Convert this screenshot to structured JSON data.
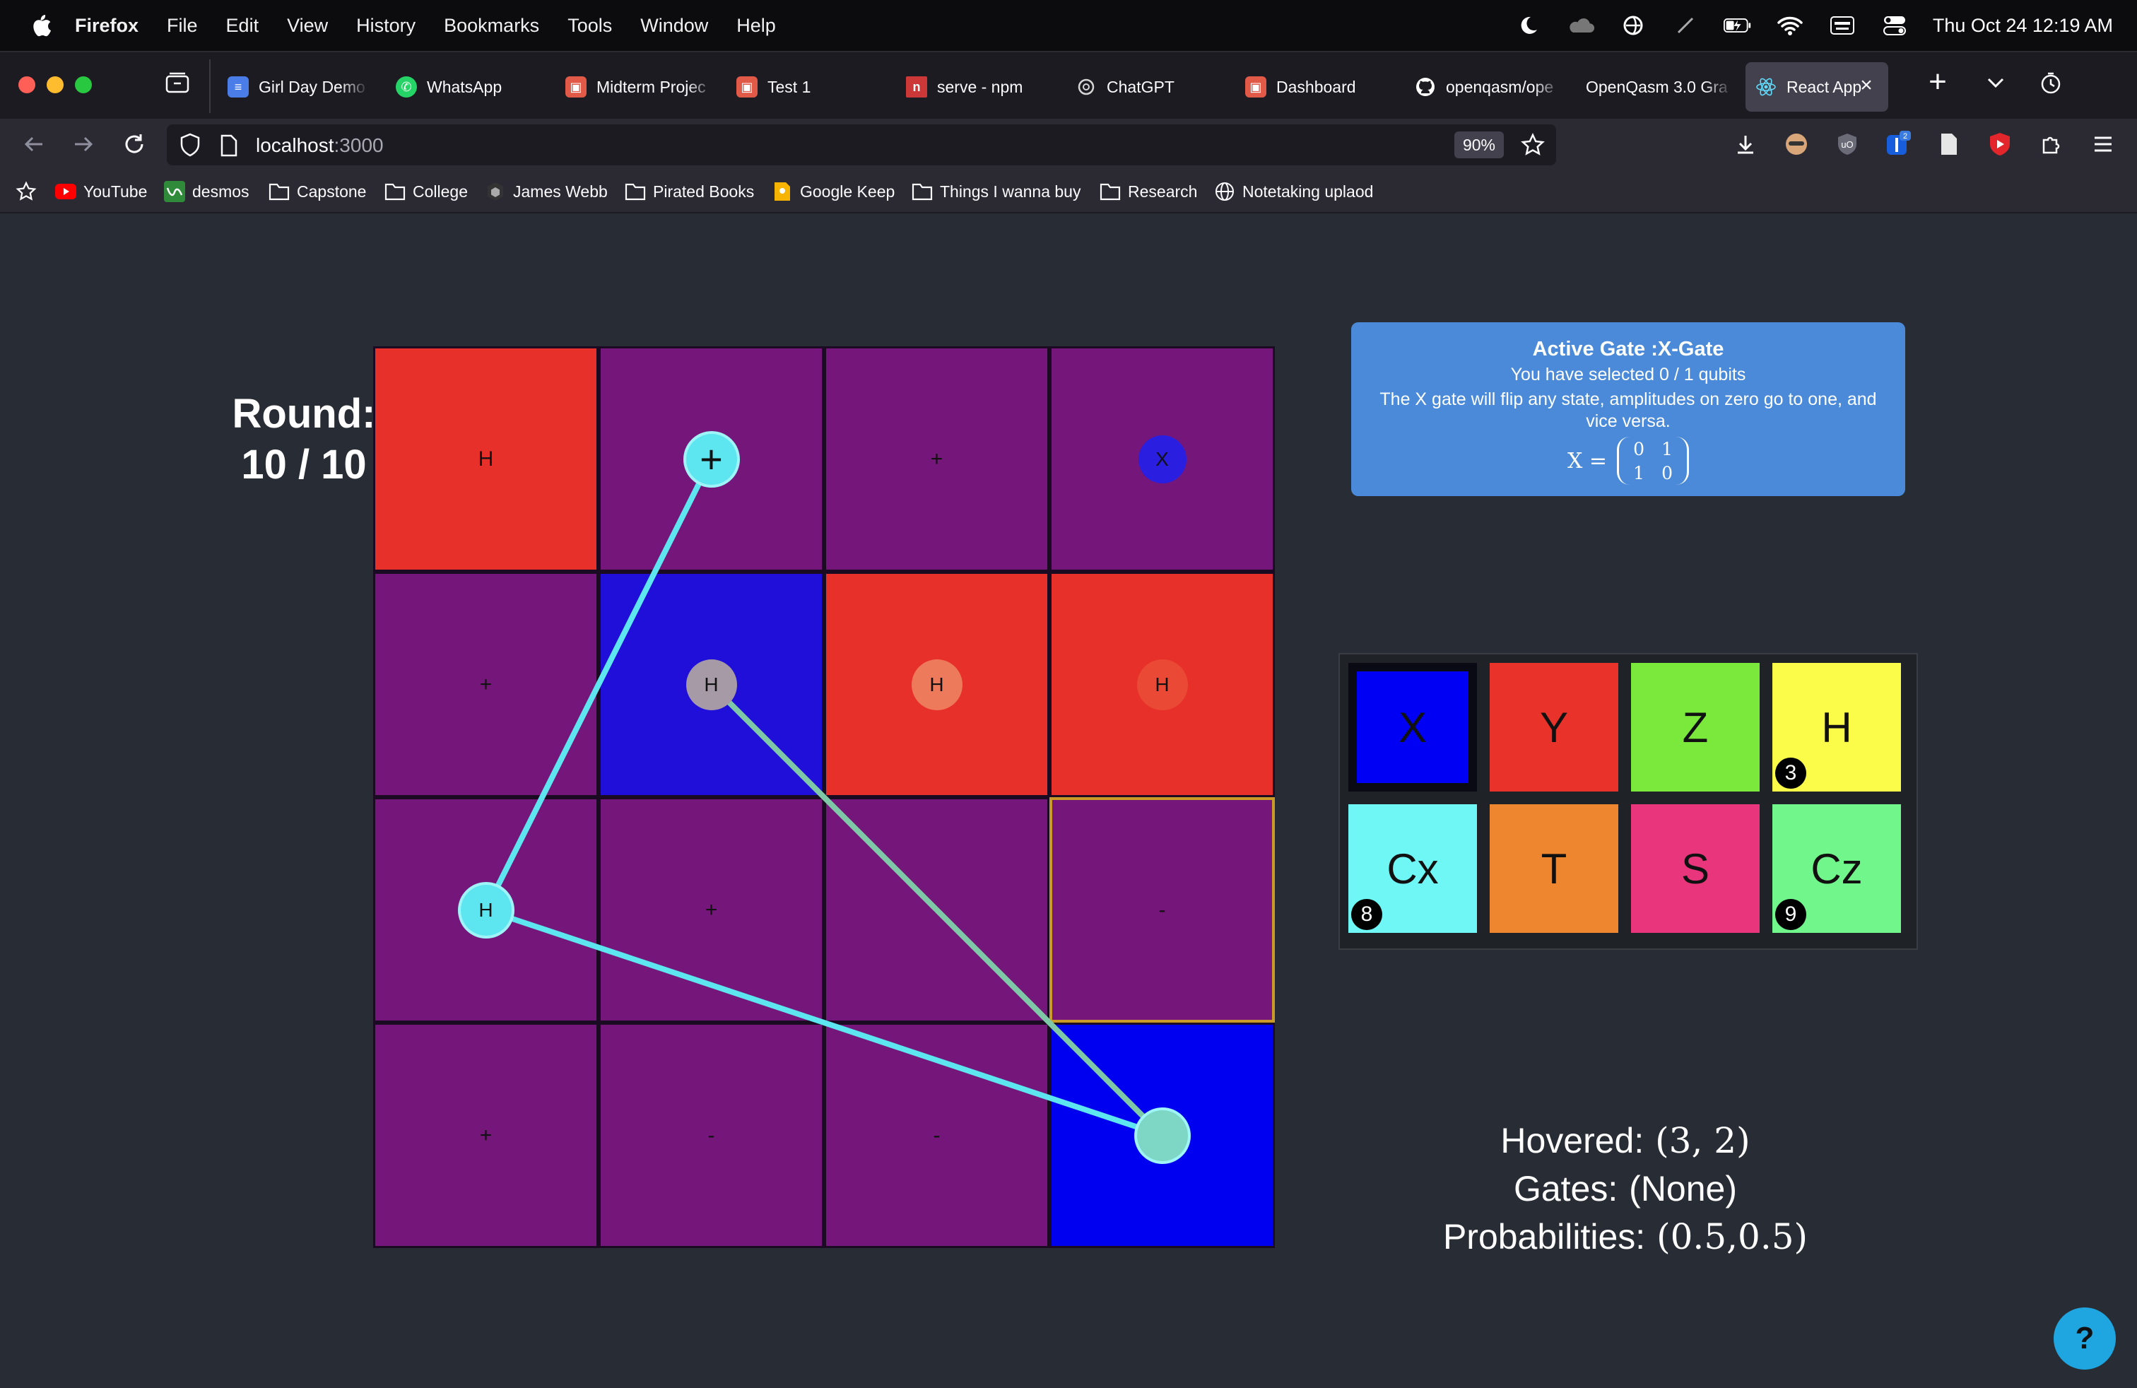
{
  "menubar": {
    "app_name": "Firefox",
    "items": [
      "File",
      "Edit",
      "View",
      "History",
      "Bookmarks",
      "Tools",
      "Window",
      "Help"
    ],
    "clock": "Thu Oct 24  12:19 AM"
  },
  "tabs": [
    {
      "title": "Girl Day Demo",
      "icon": "google-docs-icon",
      "color": "#4a7de8"
    },
    {
      "title": "WhatsApp",
      "icon": "whatsapp-icon",
      "color": "#25d366"
    },
    {
      "title": "Midterm Projec",
      "icon": "canvas-icon",
      "color": "#e05a47"
    },
    {
      "title": "Test 1",
      "icon": "canvas-icon",
      "color": "#e05a47"
    },
    {
      "title": "serve - npm",
      "icon": "npm-icon",
      "color": "#cb3837"
    },
    {
      "title": "ChatGPT",
      "icon": "chatgpt-icon",
      "color": "#d6d6d6"
    },
    {
      "title": "Dashboard",
      "icon": "canvas-icon",
      "color": "#e05a47"
    },
    {
      "title": "openqasm/ope",
      "icon": "github-icon",
      "color": "#ffffff"
    },
    {
      "title": "OpenQasm 3.0 Gra",
      "icon": "",
      "color": ""
    },
    {
      "title": "React App",
      "icon": "react-icon",
      "color": "#61dafb",
      "active": true
    }
  ],
  "address": {
    "host": "localhost",
    "port": ":3000",
    "zoom": "90%"
  },
  "bookmarks": [
    {
      "label": "YouTube",
      "icon": "youtube-icon"
    },
    {
      "label": "desmos",
      "icon": "desmos-icon"
    },
    {
      "label": "Capstone",
      "icon": "folder-icon"
    },
    {
      "label": "College",
      "icon": "folder-icon"
    },
    {
      "label": "James Webb",
      "icon": "webb-icon"
    },
    {
      "label": "Pirated Books",
      "icon": "folder-icon"
    },
    {
      "label": "Google Keep",
      "icon": "keep-icon"
    },
    {
      "label": "Things I wanna buy",
      "icon": "folder-icon"
    },
    {
      "label": "Research",
      "icon": "folder-icon"
    },
    {
      "label": "Notetaking uplaod",
      "icon": "globe-icon"
    }
  ],
  "game": {
    "round_label": "Round:",
    "round_value": "10 / 10",
    "grid": [
      [
        {
          "label": "H",
          "color": "#e8302a"
        },
        {
          "label": "+",
          "color": "#75177a",
          "marker": "cyan-large"
        },
        {
          "label": "+",
          "color": "#75177a"
        },
        {
          "label": "X",
          "color": "#75177a",
          "marker": "blue"
        }
      ],
      [
        {
          "label": "+",
          "color": "#75177a"
        },
        {
          "label": "H",
          "color": "#1f0fd9",
          "marker": "grey"
        },
        {
          "label": "H",
          "color": "#e8302a",
          "marker": "salmon"
        },
        {
          "label": "H",
          "color": "#e8302a",
          "marker": "red"
        }
      ],
      [
        {
          "label": "H",
          "color": "#75177a",
          "marker": "cyan"
        },
        {
          "label": "+",
          "color": "#75177a"
        },
        {
          "label": "-",
          "color": "#75177a"
        },
        {
          "label": "-",
          "color": "#75177a",
          "hovered": true
        }
      ],
      [
        {
          "label": "+",
          "color": "#75177a"
        },
        {
          "label": "-",
          "color": "#75177a"
        },
        {
          "label": "-",
          "color": "#75177a"
        },
        {
          "label": "",
          "color": "#0000f0",
          "marker": "cyan-green"
        }
      ]
    ],
    "link_color": "#5ee6f0",
    "link_color_alt": "#7ec8a8"
  },
  "active_gate": {
    "title": "Active Gate :X-Gate",
    "selected": "You have selected 0 / 1 qubits",
    "description": "The X gate will flip any state, amplitudes on zero go to one, and vice versa.",
    "matrix_label": "X =",
    "matrix": [
      "0",
      "1",
      "1",
      "0"
    ]
  },
  "palette": [
    {
      "label": "X",
      "color": "#0000f5",
      "selected": true,
      "badge": ""
    },
    {
      "label": "Y",
      "color": "#e8322a",
      "badge": ""
    },
    {
      "label": "Z",
      "color": "#7be83c",
      "badge": ""
    },
    {
      "label": "H",
      "color": "#fbfc4a",
      "badge": "3"
    },
    {
      "label": "Cx",
      "color": "#6ff7f6",
      "badge": "8"
    },
    {
      "label": "T",
      "color": "#ee8630",
      "badge": ""
    },
    {
      "label": "S",
      "color": "#e8357c",
      "badge": ""
    },
    {
      "label": "Cz",
      "color": "#70f68a",
      "badge": "9"
    }
  ],
  "status": {
    "hovered_label": "Hovered:",
    "hovered_value": "(3, 2)",
    "gates_label": "Gates:",
    "gates_value": "(None)",
    "prob_label": "Probabilities:",
    "prob_value": "(0.5,0.5)"
  },
  "help_label": "?"
}
